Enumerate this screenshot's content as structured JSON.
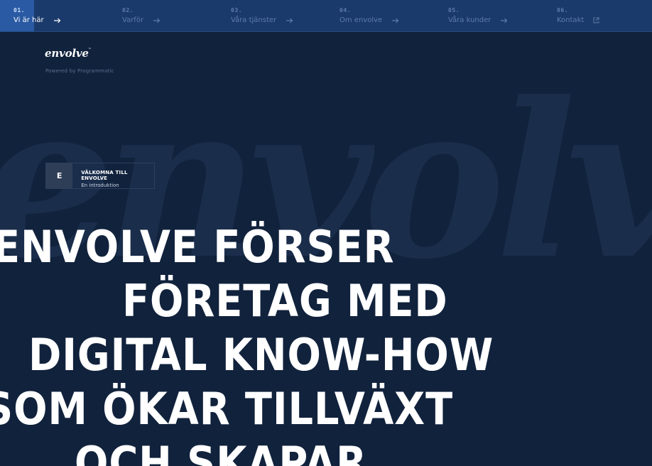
{
  "nav": {
    "items": [
      {
        "num": "01.",
        "label": "Vi är här",
        "icon": "arrow-right-icon",
        "active": true
      },
      {
        "num": "02.",
        "label": "Varför",
        "icon": "arrow-right-icon",
        "active": false
      },
      {
        "num": "03.",
        "label": "Våra tjänster",
        "icon": "arrow-right-icon",
        "active": false
      },
      {
        "num": "04.",
        "label": "Om envolve",
        "icon": "arrow-right-icon",
        "active": false
      },
      {
        "num": "05.",
        "label": "Våra kunder",
        "icon": "arrow-right-icon",
        "active": false
      },
      {
        "num": "06.",
        "label": "Kontakt",
        "icon": "external-link-icon",
        "active": false
      }
    ]
  },
  "brand": {
    "logo": "envolve",
    "tm": "™",
    "powered_by": "Powered by Programmatic",
    "watermark": "envolve"
  },
  "intro": {
    "letter": "E",
    "title": "VÄLKOMNA TILL ENVOLVE",
    "subtitle": "En introduktion"
  },
  "headline": {
    "lines": [
      "ENVOLVE FÖRSER",
      "FÖRETAG MED",
      "DIGITAL KNOW-HOW",
      "SOM ÖKAR TILLVÄXT",
      "OCH SKAPAR"
    ]
  },
  "colors": {
    "background": "#11223c",
    "nav_bg": "#1a3a6b",
    "nav_active": "#2a5aa3",
    "nav_muted_text": "#5d7cab",
    "watermark": "#1a2d4b"
  }
}
